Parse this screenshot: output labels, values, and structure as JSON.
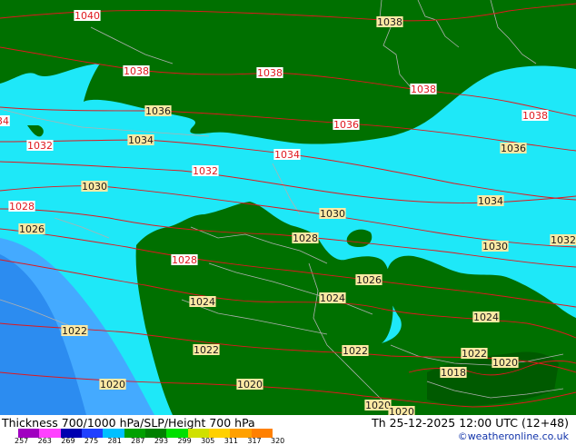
{
  "header": {
    "title": "Thickness 700/1000 hPa/SLP/Height 700 hPa",
    "datetime": "Th 25-12-2025 12:00 UTC (12+48)",
    "credit": "©weatheronline.co.uk"
  },
  "colors": {
    "dark_green": "#007000",
    "cyan": "#1ee8f8",
    "light_blue": "#44aaff",
    "mid_blue": "#2c8cf0",
    "isobar": "#e0181e",
    "border": "#b0b0b0"
  },
  "legend": {
    "ticks": [
      "257",
      "263",
      "269",
      "275",
      "281",
      "287",
      "293",
      "299",
      "305",
      "311",
      "317",
      "320"
    ],
    "colors": [
      "#a000c0",
      "#ff40ff",
      "#0000b0",
      "#2040ff",
      "#00c0ff",
      "#00a000",
      "#008000",
      "#00e000",
      "#d0e000",
      "#ffd000",
      "#ffa000",
      "#ff8000"
    ]
  },
  "isobar_labels": [
    {
      "text": "1040",
      "highlight": true
    },
    {
      "text": "1038",
      "highlight": false
    },
    {
      "text": "1038",
      "highlight": true
    },
    {
      "text": "1038",
      "highlight": true
    },
    {
      "text": "1038",
      "highlight": true
    },
    {
      "text": "1038",
      "highlight": true
    },
    {
      "text": "1036",
      "highlight": false
    },
    {
      "text": "1036",
      "highlight": true
    },
    {
      "text": "1036",
      "highlight": false
    },
    {
      "text": "34",
      "highlight": true
    },
    {
      "text": "1032",
      "highlight": true
    },
    {
      "text": "1034",
      "highlight": false
    },
    {
      "text": "1034",
      "highlight": true
    },
    {
      "text": "1032",
      "highlight": true
    },
    {
      "text": "1034",
      "highlight": false
    },
    {
      "text": "1030",
      "highlight": false
    },
    {
      "text": "1028",
      "highlight": true
    },
    {
      "text": "1030",
      "highlight": false
    },
    {
      "text": "1026",
      "highlight": false
    },
    {
      "text": "1028",
      "highlight": false
    },
    {
      "text": "1030",
      "highlight": false
    },
    {
      "text": "1032",
      "highlight": false
    },
    {
      "text": "1028",
      "highlight": true
    },
    {
      "text": "1026",
      "highlight": false
    },
    {
      "text": "1024",
      "highlight": false
    },
    {
      "text": "1024",
      "highlight": false
    },
    {
      "text": "1024",
      "highlight": false
    },
    {
      "text": "1022",
      "highlight": false
    },
    {
      "text": "1022",
      "highlight": false
    },
    {
      "text": "1022",
      "highlight": false
    },
    {
      "text": "1022",
      "highlight": false
    },
    {
      "text": "1018",
      "highlight": false
    },
    {
      "text": "1020",
      "highlight": false
    },
    {
      "text": "1020",
      "highlight": false
    },
    {
      "text": "1020",
      "highlight": false
    },
    {
      "text": "1020",
      "highlight": false
    },
    {
      "text": "1020",
      "highlight": false
    }
  ]
}
